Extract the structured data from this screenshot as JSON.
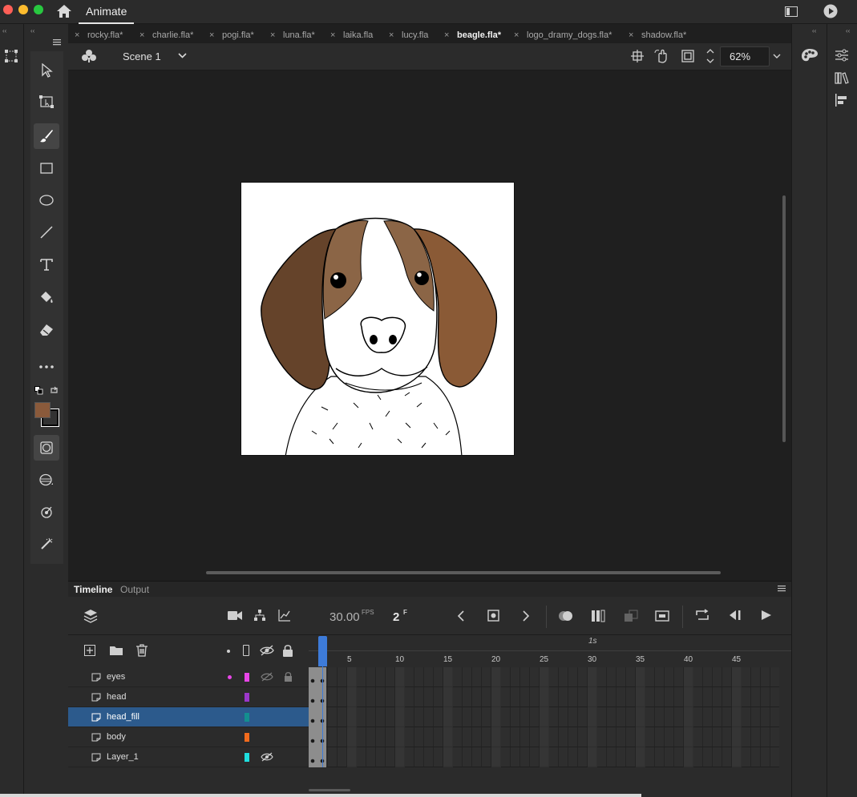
{
  "app": {
    "name": "Animate"
  },
  "tabs": [
    {
      "label": "rocky.fla*",
      "active": false
    },
    {
      "label": "charlie.fla*",
      "active": false
    },
    {
      "label": "pogi.fla*",
      "active": false
    },
    {
      "label": "luna.fla*",
      "active": false
    },
    {
      "label": "laika.fla",
      "active": false
    },
    {
      "label": "lucy.fla",
      "active": false
    },
    {
      "label": "beagle.fla*",
      "active": true
    },
    {
      "label": "logo_dramy_dogs.fla*",
      "active": false
    },
    {
      "label": "shadow.fla*",
      "active": false
    }
  ],
  "tab_close_glyph": "×",
  "stage": {
    "scene": "Scene 1",
    "zoom": "62%"
  },
  "colors": {
    "fill_swatch": "#8a5a3b",
    "stroke_swatch": "#000000",
    "selected_layer": "#2c5a8c",
    "playhead": "#3d7bd9"
  },
  "timeline": {
    "tabs": [
      "Timeline",
      "Output"
    ],
    "fps": "30.00",
    "fps_unit": "FPS",
    "frame": "2",
    "frame_unit": "F",
    "seconds_marker": "1s",
    "ruler": [
      "5",
      "10",
      "15",
      "20",
      "25",
      "30",
      "35",
      "40",
      "45"
    ],
    "layers": [
      {
        "name": "eyes",
        "color": "#e846e8",
        "hidden_icon": true,
        "lock_icon": true,
        "active_dot": true,
        "selected": false
      },
      {
        "name": "head",
        "color": "#9b37c9",
        "hidden_icon": false,
        "lock_icon": false,
        "active_dot": false,
        "selected": false
      },
      {
        "name": "head_fill",
        "color": "#138f8f",
        "hidden_icon": false,
        "lock_icon": false,
        "active_dot": false,
        "selected": true
      },
      {
        "name": "body",
        "color": "#f26b1d",
        "hidden_icon": false,
        "lock_icon": false,
        "active_dot": false,
        "selected": false
      },
      {
        "name": "Layer_1",
        "color": "#1fdede",
        "hidden_icon": true,
        "lock_icon": false,
        "active_dot": false,
        "selected": false
      }
    ]
  },
  "tools": [
    "selection-tool",
    "subselection-tool",
    "brush-tool",
    "rectangle-tool",
    "oval-tool",
    "line-tool",
    "text-tool",
    "paint-bucket-tool",
    "eraser-tool",
    "more-tools"
  ]
}
